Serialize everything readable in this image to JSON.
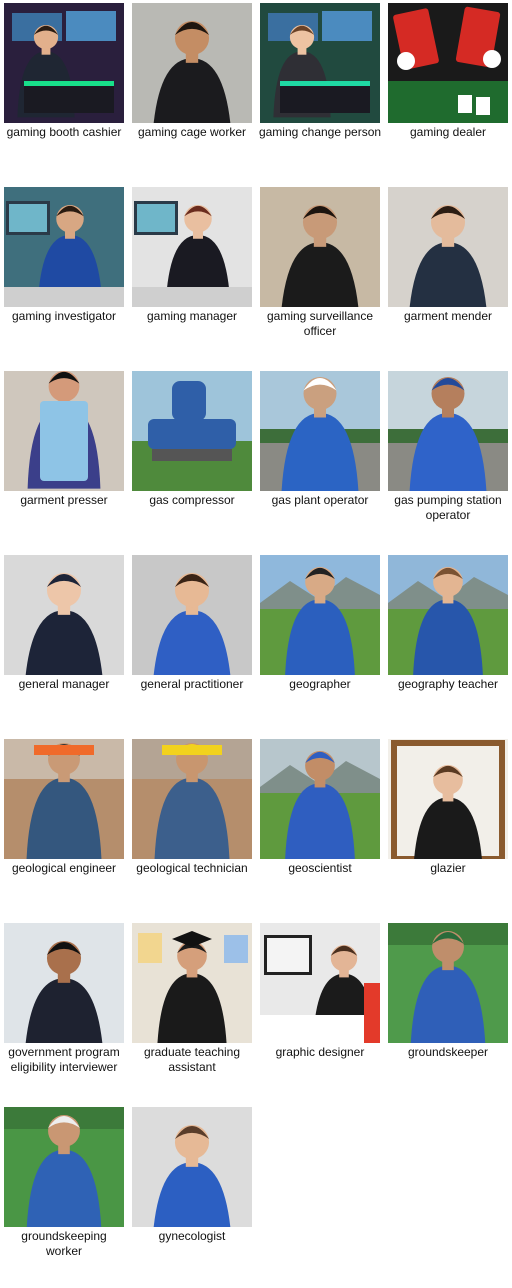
{
  "gallery": {
    "items": [
      {
        "caption": "gaming booth cashier",
        "scene": "gaming",
        "bg": "#2a1f3d",
        "accent": "#18e08a",
        "skin": "#e2b08c",
        "clothing": "#1f2633",
        "hair": "#2b1c12"
      },
      {
        "caption": "gaming cage worker",
        "scene": "portrait",
        "bg": "#b9b9b4",
        "accent": "#2a56c8",
        "skin": "#c48d64",
        "clothing": "#1b1b1e",
        "hair": "#1e1610"
      },
      {
        "caption": "gaming change person",
        "scene": "gaming",
        "bg": "#214a3f",
        "accent": "#1fd9a4",
        "skin": "#edc3a2",
        "clothing": "#2f2f35",
        "hair": "#6b4226"
      },
      {
        "caption": "gaming dealer",
        "scene": "cards",
        "bg": "#1a1a1a",
        "accent": "#d52a24",
        "skin": "#ffffff",
        "clothing": "#111111",
        "hair": "#111111"
      },
      {
        "caption": "gaming investigator",
        "scene": "office",
        "bg": "#3f6f7d",
        "accent": "#2d5fbf",
        "skin": "#d8a783",
        "clothing": "#1f4aa3",
        "hair": "#2a1b10"
      },
      {
        "caption": "gaming manager",
        "scene": "office",
        "bg": "#e3e3e3",
        "accent": "#3a9ab3",
        "skin": "#e9bfa0",
        "clothing": "#1a1a22",
        "hair": "#6a2c1e"
      },
      {
        "caption": "gaming surveillance officer",
        "scene": "portrait",
        "bg": "#c7b9a4",
        "accent": "#222222",
        "skin": "#c89a78",
        "clothing": "#1b1b1b",
        "hair": "#1d140e"
      },
      {
        "caption": "garment mender",
        "scene": "portrait",
        "bg": "#d6d2cc",
        "accent": "#243042",
        "skin": "#e4bb9c",
        "clothing": "#243042",
        "hair": "#2c1d13"
      },
      {
        "caption": "garment presser",
        "scene": "garment",
        "bg": "#cfc7bd",
        "accent": "#8ec4e6",
        "skin": "#d49a7a",
        "clothing": "#3b3f8a",
        "hair": "#111111"
      },
      {
        "caption": "gas compressor",
        "scene": "machine",
        "bg": "#9ec4da",
        "accent": "#2f5fa8",
        "skin": "#000000",
        "clothing": "#000000",
        "hair": "#000000"
      },
      {
        "caption": "gas plant operator",
        "scene": "worker",
        "bg": "#a9c7da",
        "accent": "#2b64c4",
        "skin": "#caa07f",
        "clothing": "#2b64c4",
        "hair": "#ffffff"
      },
      {
        "caption": "gas pumping station operator",
        "scene": "worker",
        "bg": "#c6d5dc",
        "accent": "#2f63c9",
        "skin": "#b57f5d",
        "clothing": "#2f63c9",
        "hair": "#234a9a"
      },
      {
        "caption": "general manager",
        "scene": "portrait",
        "bg": "#d9d9d9",
        "accent": "#ffffff",
        "skin": "#edc6a9",
        "clothing": "#1d2438",
        "hair": "#1d2438"
      },
      {
        "caption": "general practitioner",
        "scene": "portrait",
        "bg": "#c8c8c8",
        "accent": "#2f5fc4",
        "skin": "#e7b995",
        "clothing": "#2f5fc4",
        "hair": "#3a2416"
      },
      {
        "caption": "geographer",
        "scene": "landscape",
        "bg": "#8fb8dc",
        "accent": "#2b5fbe",
        "skin": "#d8aa86",
        "clothing": "#2b5fbe",
        "hair": "#222222"
      },
      {
        "caption": "geography teacher",
        "scene": "landscape",
        "bg": "#90b7d9",
        "accent": "#2756ab",
        "skin": "#e3b592",
        "clothing": "#2756ab",
        "hair": "#7a5232"
      },
      {
        "caption": "geological engineer",
        "scene": "desert",
        "bg": "#c9b9a8",
        "accent": "#f06a2a",
        "skin": "#c99a76",
        "clothing": "#34577e",
        "hair": "#333333"
      },
      {
        "caption": "geological technician",
        "scene": "desert",
        "bg": "#b4a494",
        "accent": "#f2d21d",
        "skin": "#c8966f",
        "clothing": "#3c5f8c",
        "hair": "#f2d21d"
      },
      {
        "caption": "geoscientist",
        "scene": "landscape",
        "bg": "#b7c6cc",
        "accent": "#2f5ec0",
        "skin": "#c28d67",
        "clothing": "#2f5ec0",
        "hair": "#2f5ec0"
      },
      {
        "caption": "glazier",
        "scene": "frame",
        "bg": "#f2efe9",
        "accent": "#8a5a2e",
        "skin": "#e7bd9e",
        "clothing": "#1a1a1a",
        "hair": "#5a3a22"
      },
      {
        "caption": "government program eligibility interviewer",
        "scene": "portrait",
        "bg": "#dfe4e8",
        "accent": "#1e2230",
        "skin": "#a9704c",
        "clothing": "#1e2230",
        "hair": "#111111"
      },
      {
        "caption": "graduate teaching assistant",
        "scene": "graduate",
        "bg": "#e8e2d6",
        "accent": "#1a1a1a",
        "skin": "#d59f7b",
        "clothing": "#1a1a1a",
        "hair": "#1a1a1a"
      },
      {
        "caption": "graphic designer",
        "scene": "designer",
        "bg": "#e9e9e9",
        "accent": "#e33a2a",
        "skin": "#e3b596",
        "clothing": "#1b1b1b",
        "hair": "#4a2f1e"
      },
      {
        "caption": "groundskeeper",
        "scene": "field",
        "bg": "#4f9a4b",
        "accent": "#2f5fb8",
        "skin": "#bf8e6b",
        "clothing": "#2f5fb8",
        "hair": "#2a6b3a"
      },
      {
        "caption": "groundskeeping worker",
        "scene": "field",
        "bg": "#4a9645",
        "accent": "#f2d526",
        "skin": "#c99773",
        "clothing": "#2f62b5",
        "hair": "#eeeeee"
      },
      {
        "caption": "gynecologist",
        "scene": "portrait",
        "bg": "#dcdcdc",
        "accent": "#7fd3e6",
        "skin": "#e6b996",
        "clothing": "#2c5fc2",
        "hair": "#5a3d2a"
      }
    ]
  }
}
